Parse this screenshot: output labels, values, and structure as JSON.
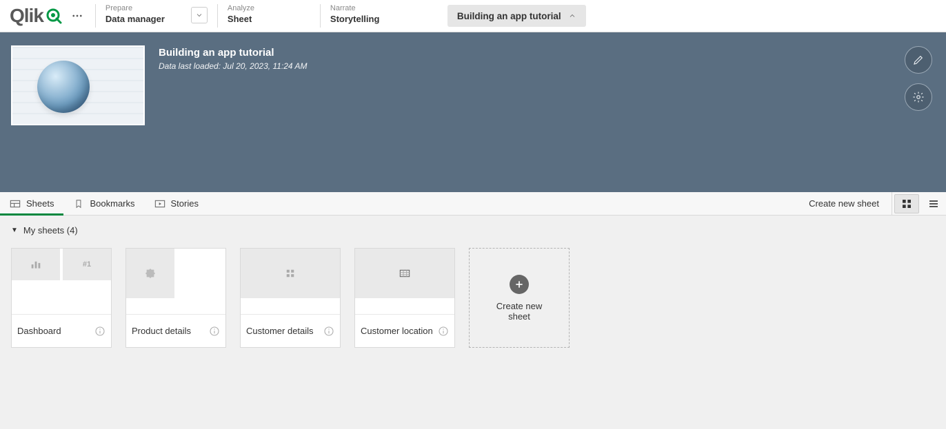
{
  "logo": {
    "text": "Qlik"
  },
  "topnav": {
    "prepare": {
      "label": "Prepare",
      "selection": "Data manager"
    },
    "analyze": {
      "label": "Analyze",
      "selection": "Sheet"
    },
    "narrate": {
      "label": "Narrate",
      "selection": "Storytelling"
    }
  },
  "app_button": {
    "label": "Building an app tutorial"
  },
  "hero": {
    "title": "Building an app tutorial",
    "subtitle": "Data last loaded: Jul 20, 2023, 11:24 AM"
  },
  "tabs": {
    "sheets": "Sheets",
    "bookmarks": "Bookmarks",
    "stories": "Stories"
  },
  "create_link": "Create new sheet",
  "section": {
    "label": "My sheets (4)"
  },
  "sheets": [
    {
      "title": "Dashboard"
    },
    {
      "title": "Product details"
    },
    {
      "title": "Customer details"
    },
    {
      "title": "Customer location"
    }
  ],
  "create_card": {
    "label": "Create new sheet"
  },
  "icons": {
    "more": "more-horizontal-icon",
    "chevron_down": "chevron-down-icon",
    "chevron_up": "chevron-up-icon",
    "edit": "pencil-icon",
    "settings": "gear-icon",
    "sheets_tab": "layout-icon",
    "bookmark": "bookmark-icon",
    "play": "play-icon",
    "grid": "grid-icon",
    "list": "list-icon",
    "plus": "plus-icon",
    "info": "info-icon",
    "triangle": "triangle-down-icon"
  }
}
